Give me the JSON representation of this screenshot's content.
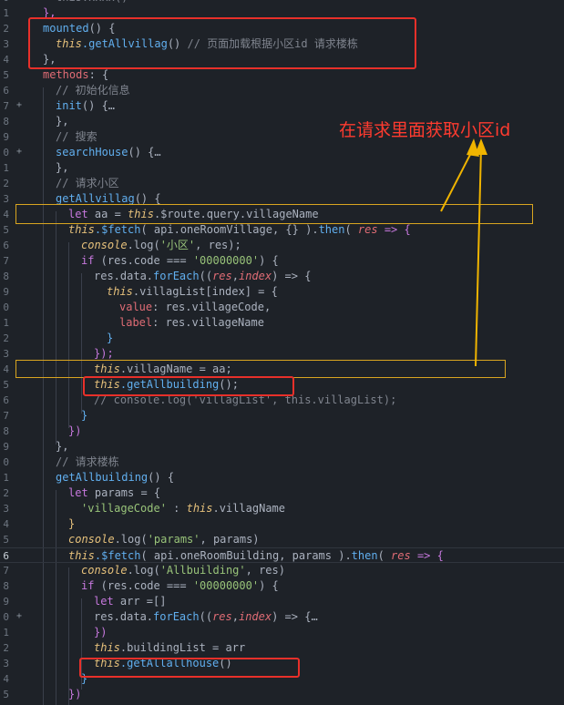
{
  "line_numbers": [
    "0",
    "1",
    "2",
    "3",
    "4",
    "5",
    "6",
    "7",
    "8",
    "9",
    "0",
    "1",
    "2",
    "3",
    "4",
    "5",
    "6",
    "7",
    "8",
    "9",
    "0",
    "1",
    "2",
    "3",
    "4",
    "5",
    "6",
    "7",
    "8",
    "9",
    "0",
    "1",
    "2",
    "3",
    "4",
    "5",
    "6",
    "7",
    "8",
    "9",
    "0",
    "1",
    "2",
    "3",
    "4",
    "5"
  ],
  "active_line_index": 35,
  "annotation": "在请求里面获取小区id",
  "colors": {
    "background": "#1e2228",
    "highlight_box": "#e8302a",
    "selection_box": "#d9a520",
    "annotation_text": "#ff3b2f"
  },
  "code": {
    "l01": "},",
    "l02a": "mounted",
    "l02b": "() {",
    "l03a": "this",
    "l03b": ".getAllvillag",
    "l03c": "()",
    "l03d": " // 页面加载根据小区id 请求楼栋",
    "l04": "},",
    "l05a": "methods",
    "l05b": ": {",
    "l06": "// 初始化信息",
    "l07a": "init",
    "l07b": "() {…",
    "l08": "},",
    "l09": "// 搜索",
    "l10a": "searchHouse",
    "l10b": "() {…",
    "l11": "},",
    "l12": "// 请求小区",
    "l13a": "getAllvillag",
    "l13b": "() {",
    "l14a": "let",
    "l14b": " aa = ",
    "l14c": "this",
    "l14d": ".$route.query.villageName",
    "l15a": "this",
    "l15b": ".$fetch",
    "l15c": "( api.oneRoomVillage, {} ).",
    "l15d": "then",
    "l15e": "( ",
    "l15f": "res",
    "l15g": " => {",
    "l16a": "console",
    "l16b": ".log(",
    "l16c": "'小区'",
    "l16d": ", res);",
    "l17a": "if",
    "l17b": " (res.code === ",
    "l17c": "'00000000'",
    "l17d": ") {",
    "l18a": "res.data.",
    "l18b": "forEach",
    "l18c": "((",
    "l18d": "res",
    "l18e": ",",
    "l18f": "index",
    "l18g": ") => {",
    "l19a": "this",
    "l19b": ".villagList[index] = {",
    "l20a": "value",
    "l20b": ": res.villageCode,",
    "l21a": "label",
    "l21b": ": res.villageName",
    "l22": "}",
    "l23": "});",
    "l24a": "this",
    "l24b": ".villagName = aa;",
    "l25a": "this",
    "l25b": ".getAllbuilding",
    "l25c": "();",
    "l26": "// console.log('villagList', this.villagList);",
    "l27": "}",
    "l28": "})",
    "l29": "},",
    "l30": "// 请求楼栋",
    "l31a": "getAllbuilding",
    "l31b": "() {",
    "l32a": "let",
    "l32b": " params = {",
    "l33a": "'villageCode'",
    "l33b": " : ",
    "l33c": "this",
    "l33d": ".villagName",
    "l34": "}",
    "l35a": "console",
    "l35b": ".log(",
    "l35c": "'params'",
    "l35d": ", params)",
    "l36a": "this",
    "l36b": ".$fetch",
    "l36c": "( api.oneRoomBuilding, params ).",
    "l36d": "then",
    "l36e": "( ",
    "l36f": "res",
    "l36g": " => {",
    "l37a": "console",
    "l37b": ".log(",
    "l37c": "'Allbuilding'",
    "l37d": ", res)",
    "l38a": "if",
    "l38b": " (res.code === ",
    "l38c": "'00000000'",
    "l38d": ") {",
    "l39a": "let",
    "l39b": " arr =[]",
    "l40a": "res.data.",
    "l40b": "forEach",
    "l40c": "((",
    "l40d": "res",
    "l40e": ",",
    "l40f": "index",
    "l40g": ") => {…",
    "l41": "})",
    "l42a": "this",
    "l42b": ".buildingList = arr",
    "l43a": "this",
    "l43b": ".getAllallhouse",
    "l43c": "()",
    "l44": "}",
    "l45": "})"
  }
}
